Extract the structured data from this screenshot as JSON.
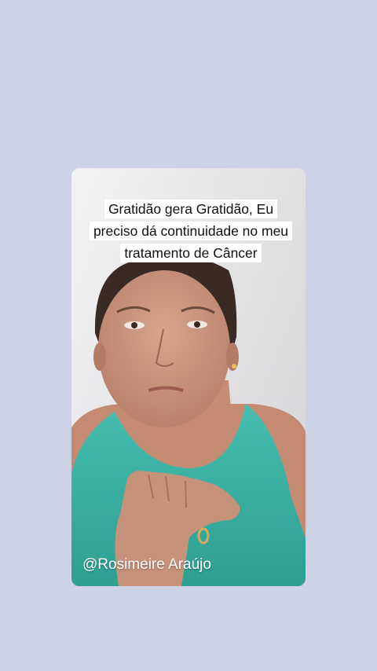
{
  "story": {
    "caption": "Gratidão gera Gratidão, Eu preciso dá continuidade no meu tratamento de Câncer",
    "author_handle": "@Rosimeire Araújo"
  },
  "colors": {
    "page_background": "#cdd3e4",
    "tank_top": "#3fb6a8",
    "caption_background": "#ffffff"
  }
}
